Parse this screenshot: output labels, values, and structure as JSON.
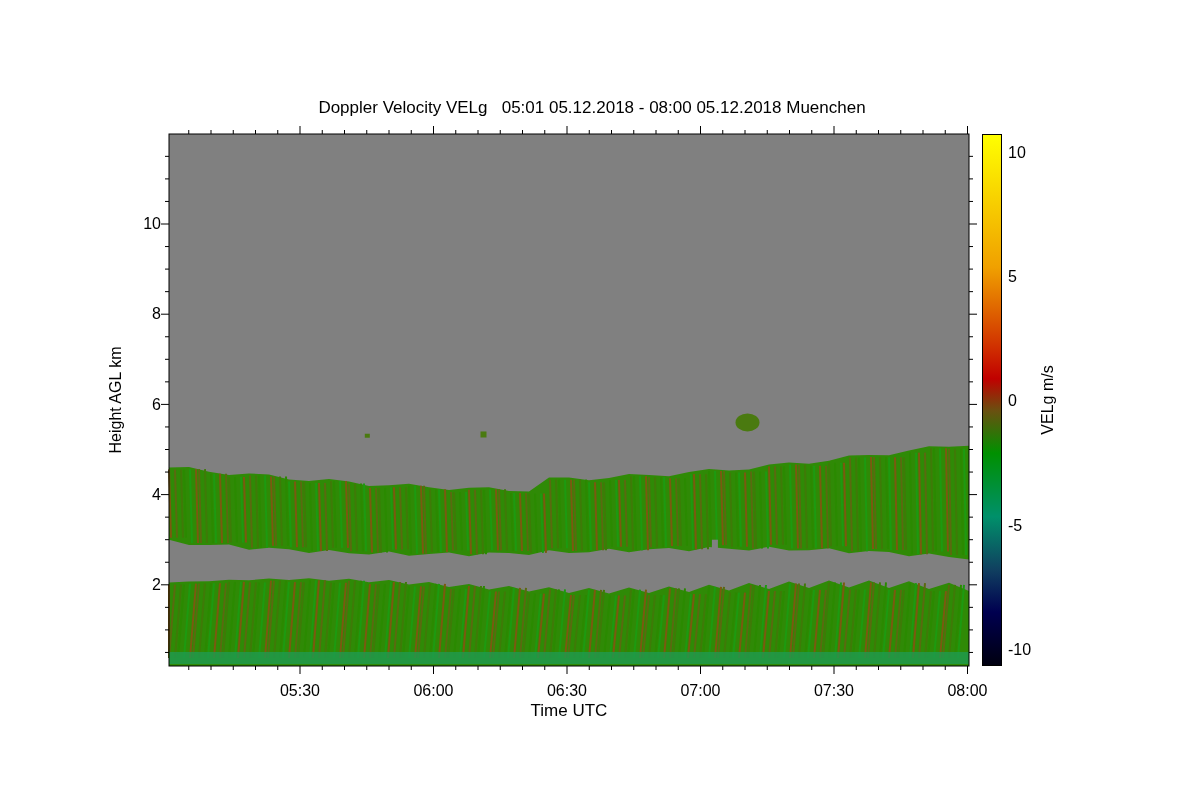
{
  "title": "Doppler Velocity VELg   05:01 05.12.2018 - 08:00 05.12.2018 Muenchen",
  "y_axis": {
    "label": "Height AGL km",
    "ticks": [
      "10",
      "8",
      "6",
      "4",
      "2"
    ]
  },
  "x_axis": {
    "label": "Time UTC",
    "ticks": [
      "05:30",
      "06:00",
      "06:30",
      "07:00",
      "07:30",
      "08:00"
    ]
  },
  "colorbar": {
    "label": "VELg m/s",
    "ticks": [
      "10",
      "5",
      "0",
      "-5",
      "-10"
    ]
  }
}
